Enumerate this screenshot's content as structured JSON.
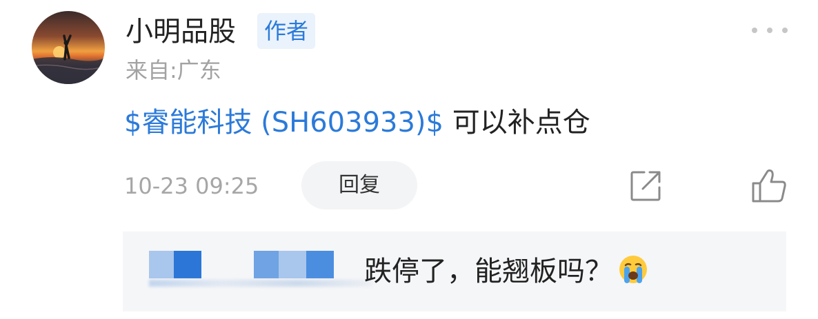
{
  "post": {
    "author": {
      "name": "小明品股",
      "badge": "作者",
      "location": "来自:广东"
    },
    "content": {
      "stock_tag": "$睿能科技 (SH603933)$",
      "text": "可以补点仓"
    },
    "timestamp": "10-23 09:25",
    "actions": {
      "reply_label": "回复",
      "more_icon": "more-dots-icon",
      "share_icon": "share-icon",
      "like_icon": "thumbs-up-icon"
    }
  },
  "reply": {
    "text": "跌停了，能翘板吗？",
    "emoji_icon": "crying-face-icon"
  },
  "colors": {
    "link_blue": "#2b7ad9",
    "badge_bg": "#eaf2fc",
    "muted_text": "#a2a2a2",
    "reply_bg": "#f5f6f8",
    "pill_bg": "#f3f4f6"
  }
}
